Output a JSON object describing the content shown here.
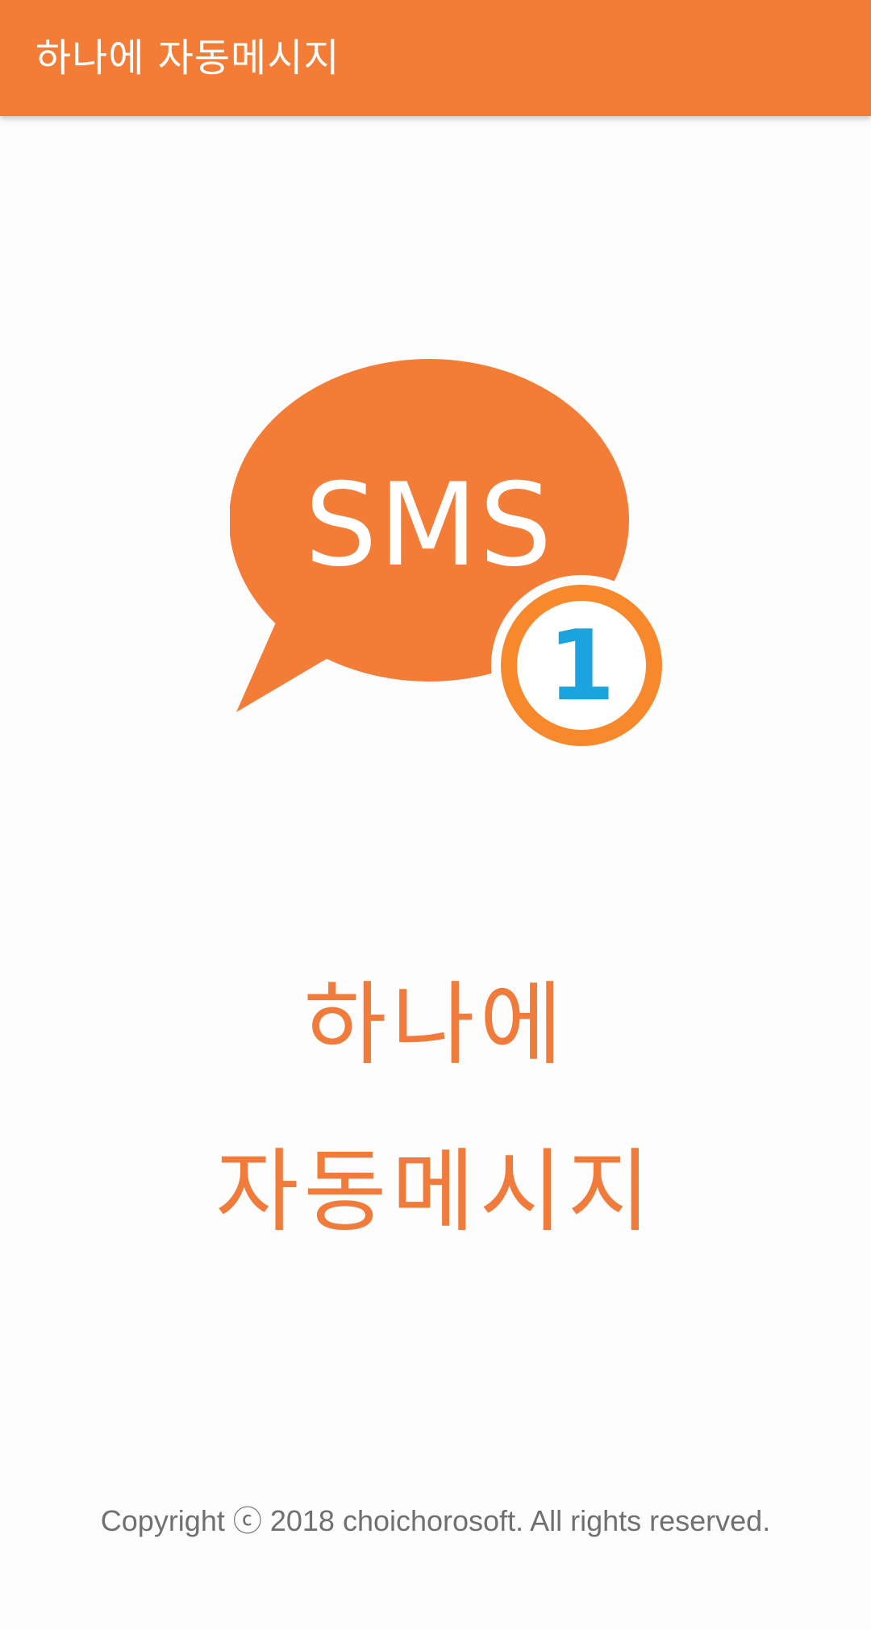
{
  "app_bar": {
    "title": "하나에 자동메시지"
  },
  "logo": {
    "icon": "sms-chat-bubble-icon",
    "bubble_text": "SMS",
    "badge_count": "1",
    "colors": {
      "bubble": "#f37c36",
      "badge_ring": "#f7882c",
      "badge_number": "#1aa3dd"
    }
  },
  "headline": {
    "line1": "하나에",
    "line2": "자동메시지"
  },
  "footer": {
    "copyright": "Copyright ⓒ 2018 choichorosoft. All rights reserved."
  },
  "colors": {
    "accent": "#f37c36",
    "background": "#fdfdfd",
    "headline": "#f07b3a",
    "footer_text": "#707070"
  }
}
